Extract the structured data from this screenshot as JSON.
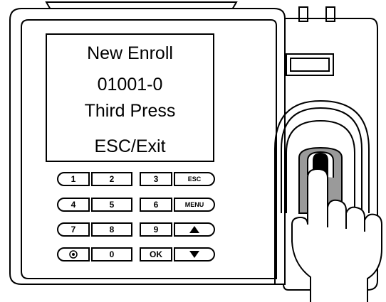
{
  "screen": {
    "line1": "New Enroll",
    "line2": "01001-0",
    "line3": "Third Press",
    "line4": "ESC/Exit"
  },
  "keypad": {
    "row1": [
      "1",
      "2",
      "3",
      "ESC"
    ],
    "row2": [
      "4",
      "5",
      "6",
      "MENU"
    ],
    "row3": [
      "7",
      "8",
      "9",
      "up-triangle-icon"
    ],
    "row4": [
      "power-icon",
      "0",
      "OK",
      "down-triangle-icon"
    ]
  },
  "colors": {
    "outline": "#000000",
    "device_body": "#ffffff",
    "finger_highlight": "#9a9a9a"
  }
}
